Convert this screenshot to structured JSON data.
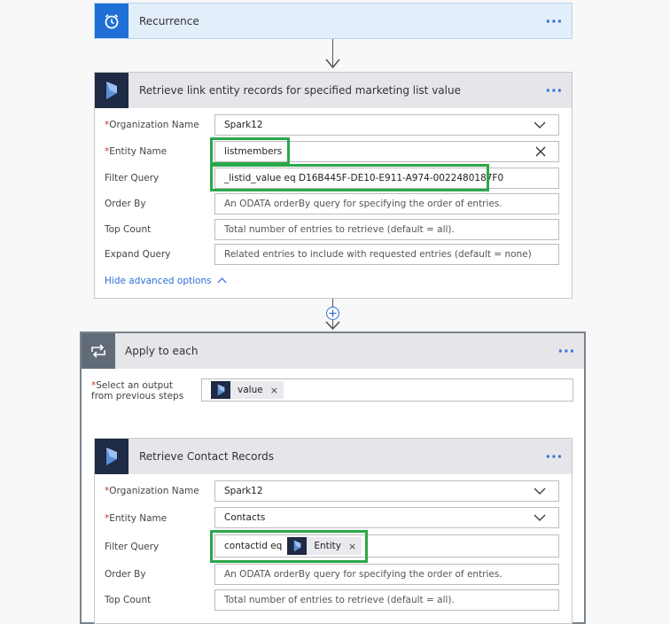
{
  "recurrence": {
    "title": "Recurrence",
    "more": "···"
  },
  "step1": {
    "title": "Retrieve link entity records for specified marketing list value",
    "more": "···",
    "fields": [
      {
        "label": "Organization Name",
        "required": "*",
        "value": "Spark12"
      },
      {
        "label": "Entity Name",
        "required": "*",
        "value": "listmembers"
      },
      {
        "label": "Filter Query",
        "value": "_listid_value eq D16B445F-DE10-E911-A974-0022480187F0"
      },
      {
        "label": "Order By",
        "placeholder": "An ODATA orderBy query for specifying the order of entries."
      },
      {
        "label": "Top Count",
        "placeholder": "Total number of entries to retrieve (default = all)."
      },
      {
        "label": "Expand Query",
        "placeholder": "Related entries to include with requested entries (default = none)"
      }
    ],
    "toggle": "Hide advanced options"
  },
  "loop": {
    "title": "Apply to each",
    "more": "···",
    "select_label_req": "*",
    "select_label_line1": "Select an output",
    "select_label_line2": "from previous steps",
    "token": "value",
    "token_remove": "×"
  },
  "step2": {
    "title": "Retrieve Contact Records",
    "more": "···",
    "fields": [
      {
        "label": "Organization Name",
        "required": "*",
        "value": "Spark12"
      },
      {
        "label": "Entity Name",
        "required": "*",
        "value": "Contacts"
      },
      {
        "label": "Filter Query",
        "value": "contactid eq",
        "token": "Entity",
        "token_remove": "×"
      },
      {
        "label": "Order By",
        "placeholder": "An ODATA orderBy query for specifying the order of entries."
      },
      {
        "label": "Top Count",
        "placeholder": "Total number of entries to retrieve (default = all)."
      }
    ]
  },
  "colors": {
    "accent": "#2e6fd6",
    "highlight": "#2aa84a",
    "dynamics": "#1f2a44",
    "recurrence": "#1f6fd6",
    "loop": "#616c78"
  }
}
